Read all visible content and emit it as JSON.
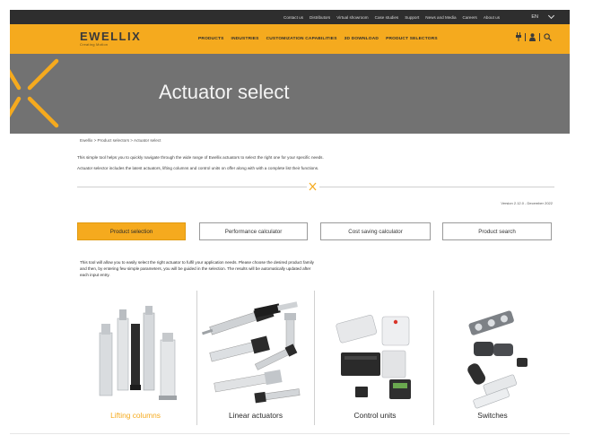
{
  "topbar": {
    "links": [
      "Contact us",
      "Distributors",
      "Virtual showroom",
      "Case studies",
      "Support",
      "News and Media",
      "Careers",
      "About us"
    ],
    "language": "EN"
  },
  "navbar": {
    "logo": "EWELLIX",
    "tagline": "Creating Motion",
    "items": [
      "PRODUCTS",
      "INDUSTRIES",
      "CUSTOMIZATION CAPABILITIES",
      "3D DOWNLOAD",
      "PRODUCT SELECTORS"
    ]
  },
  "hero": {
    "title": "Actuator select"
  },
  "breadcrumb": "Ewellix > Product selectors > Actuator select",
  "intro": {
    "line1": "This simple tool helps you to quickly navigate through the wide range of Ewellix actuators to select the right one for your specific needs.",
    "line2": "Actuator selector includes the latest actuators, lifting columns and control units on offer along with with a complete list their functions."
  },
  "version": "Version 2.12.0 - December 2022",
  "tabs": [
    {
      "label": "Product selection",
      "active": true
    },
    {
      "label": "Performance calculator",
      "active": false
    },
    {
      "label": "Cost saving calculator",
      "active": false
    },
    {
      "label": "Product search",
      "active": false
    }
  ],
  "description": {
    "line1": "This tool will allow you to easily select the right actuator to fulfil your application needs. Please choose the desired product family",
    "line2": "and then, by entering few simple parameters, you will be guided in the selection. The results will be automatically updated after",
    "line3": "each input entry."
  },
  "products": [
    {
      "label": "Lifting columns",
      "active": true
    },
    {
      "label": "Linear actuators",
      "active": false
    },
    {
      "label": "Control units",
      "active": false
    },
    {
      "label": "Switches",
      "active": false
    }
  ],
  "colors": {
    "accent": "#f5aa1e",
    "dark": "#2e2e2e",
    "hero": "#727272"
  },
  "icons": [
    "power-plug-icon",
    "user-icon",
    "search-icon",
    "chevron-down-icon"
  ]
}
